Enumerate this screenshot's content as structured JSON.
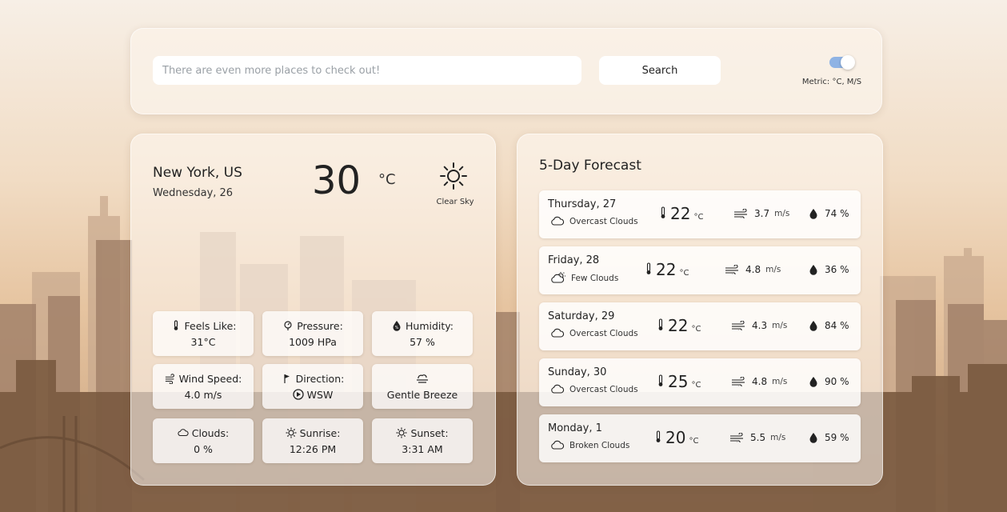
{
  "search": {
    "placeholder": "There are even more places to check out!",
    "button_label": "Search",
    "units_label": "Metric: °C, M/S",
    "units_toggle_on": true
  },
  "current": {
    "city": "New York, US",
    "date": "Wednesday, 26",
    "temperature": "30",
    "temp_unit": "°C",
    "condition": "Clear Sky",
    "condition_icon": "sun-icon",
    "details": {
      "feels_like": {
        "label": "Feels Like:",
        "value": "31°C",
        "icon": "thermometer-icon"
      },
      "pressure": {
        "label": "Pressure:",
        "value": "1009 HPa",
        "icon": "pressure-icon"
      },
      "humidity": {
        "label": "Humidity:",
        "value": "57 %",
        "icon": "humidity-icon"
      },
      "wind_speed": {
        "label": "Wind Speed:",
        "value": "4.0",
        "unit": "m/s",
        "icon": "wind-icon"
      },
      "direction": {
        "label": "Direction:",
        "value": "WSW",
        "icon": "flag-icon"
      },
      "breeze": {
        "value": "Gentle Breeze",
        "icon": "breeze-icon"
      },
      "clouds": {
        "label": "Clouds:",
        "value": "0 %",
        "icon": "cloud-icon"
      },
      "sunrise": {
        "label": "Sunrise:",
        "value": "12:26 PM",
        "icon": "sunrise-icon"
      },
      "sunset": {
        "label": "Sunset:",
        "value": "3:31 AM",
        "icon": "sunset-icon"
      }
    }
  },
  "forecast": {
    "title": "5-Day Forecast",
    "days": [
      {
        "day": "Thursday, 27",
        "condition": "Overcast Clouds",
        "icon": "cloud-icon",
        "temp": "22",
        "temp_unit": "°C",
        "wind": "3.7",
        "wind_unit": "m/s",
        "humidity": "74 %"
      },
      {
        "day": "Friday, 28",
        "condition": "Few Clouds",
        "icon": "partly-cloudy-icon",
        "temp": "22",
        "temp_unit": "°C",
        "wind": "4.8",
        "wind_unit": "m/s",
        "humidity": "36 %"
      },
      {
        "day": "Saturday, 29",
        "condition": "Overcast Clouds",
        "icon": "cloud-icon",
        "temp": "22",
        "temp_unit": "°C",
        "wind": "4.3",
        "wind_unit": "m/s",
        "humidity": "84 %"
      },
      {
        "day": "Sunday, 30",
        "condition": "Overcast Clouds",
        "icon": "cloud-icon",
        "temp": "25",
        "temp_unit": "°C",
        "wind": "4.8",
        "wind_unit": "m/s",
        "humidity": "90 %"
      },
      {
        "day": "Monday, 1",
        "condition": "Broken Clouds",
        "icon": "cloud-icon",
        "temp": "20",
        "temp_unit": "°C",
        "wind": "5.5",
        "wind_unit": "m/s",
        "humidity": "59 %"
      }
    ]
  },
  "colors": {
    "toggle_accent": "#8fb3e4",
    "skyline_light": "#c4a285",
    "skyline_dark": "#7a5a40"
  }
}
